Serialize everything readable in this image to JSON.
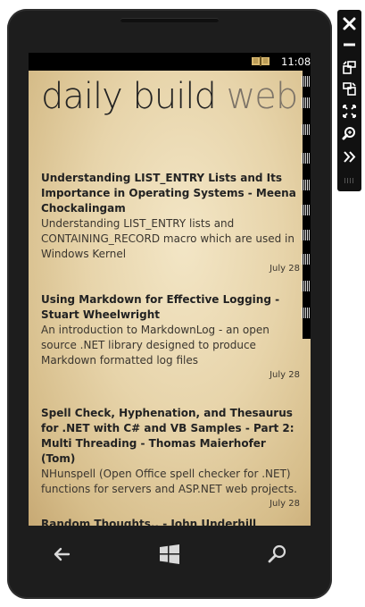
{
  "status": {
    "time": "11:08"
  },
  "panorama": {
    "title": "daily build",
    "next": "web"
  },
  "posts": [
    {
      "title": "Understanding LIST_ENTRY Lists and Its Importance in Operating Systems - Meena Chockalingam",
      "description": "Understanding LIST_ENTRY lists and CONTAINING_RECORD macro which are used in Windows Kernel",
      "date": "July 28"
    },
    {
      "title": "Using Markdown for Effective Logging - Stuart Wheelwright",
      "description": "An introduction to MarkdownLog - an open source .NET library designed to produce Markdown formatted log files",
      "date": "July 28"
    },
    {
      "title": "Spell Check, Hyphenation, and Thesaurus for .NET with C# and VB Samples - Part 2: Multi Threading - Thomas Maierhofer (Tom)",
      "description": "NHunspell (Open Office spell checker for .NET) functions for servers and ASP.NET web projects.",
      "date": "July 28"
    },
    {
      "title": "Random Thoughts.. - John Underhill",
      "description": "",
      "date": ""
    }
  ],
  "navbar": {
    "icons": [
      "back-icon",
      "windows-start-icon",
      "search-icon"
    ]
  },
  "toolbar": {
    "icons": [
      "close-icon",
      "minimize-icon",
      "rotate-left-icon",
      "rotate-right-icon",
      "fit-to-screen-icon",
      "zoom-icon",
      "more-chevron-icon"
    ]
  }
}
